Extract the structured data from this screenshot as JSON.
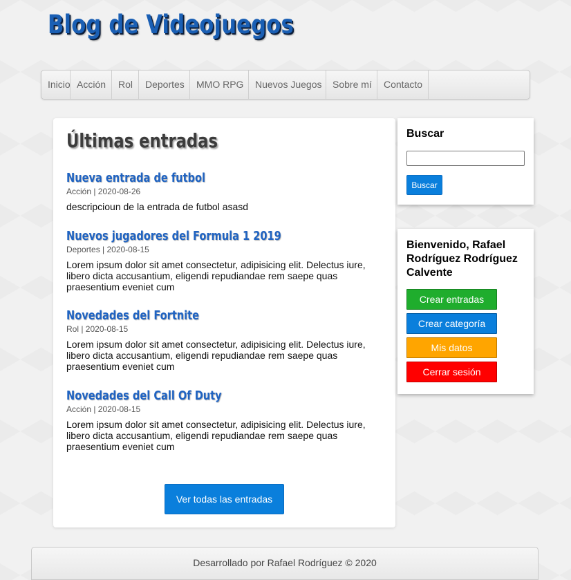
{
  "site": {
    "title": "Blog de Videojuegos"
  },
  "nav": {
    "items": [
      {
        "label": "Inicio"
      },
      {
        "label": "Acción"
      },
      {
        "label": "Rol"
      },
      {
        "label": "Deportes"
      },
      {
        "label": "MMO RPG"
      },
      {
        "label": "Nuevos Juegos"
      },
      {
        "label": "Sobre mí"
      },
      {
        "label": "Contacto"
      }
    ]
  },
  "main": {
    "heading": "Últimas entradas",
    "entries": [
      {
        "title": "Nueva entrada de futbol",
        "meta": "Acción | 2020-08-26",
        "description": "descripcioun de la entrada de futbol asasd"
      },
      {
        "title": "Nuevos jugadores del Formula 1 2019",
        "meta": "Deportes | 2020-08-15",
        "description": "Lorem ipsum dolor sit amet consectetur, adipisicing elit. Delectus iure, libero dicta accusantium, eligendi repudiandae rem saepe quas praesentium eveniet cum"
      },
      {
        "title": "Novedades del Fortnite",
        "meta": "Rol | 2020-08-15",
        "description": "Lorem ipsum dolor sit amet consectetur, adipisicing elit. Delectus iure, libero dicta accusantium, eligendi repudiandae rem saepe quas praesentium eveniet cum"
      },
      {
        "title": "Novedades del Call Of Duty",
        "meta": "Acción | 2020-08-15",
        "description": "Lorem ipsum dolor sit amet consectetur, adipisicing elit. Delectus iure, libero dicta accusantium, eligendi repudiandae rem saepe quas praesentium eveniet cum"
      }
    ],
    "view_all_label": "Ver todas las entradas"
  },
  "sidebar": {
    "search": {
      "title": "Buscar",
      "input_value": "",
      "button_label": "Buscar"
    },
    "user": {
      "welcome": "Bienvenido, Rafael Rodríguez Rodríguez Calvente",
      "actions": [
        {
          "label": "Crear entradas",
          "color": "#1fad2d"
        },
        {
          "label": "Crear categoría",
          "color": "#0a7fdc"
        },
        {
          "label": "Mis datos",
          "color": "#ffa500"
        },
        {
          "label": "Cerrar sesión",
          "color": "#ff0000"
        }
      ]
    }
  },
  "footer": {
    "text": "Desarrollado por Rafael Rodríguez © 2020"
  }
}
